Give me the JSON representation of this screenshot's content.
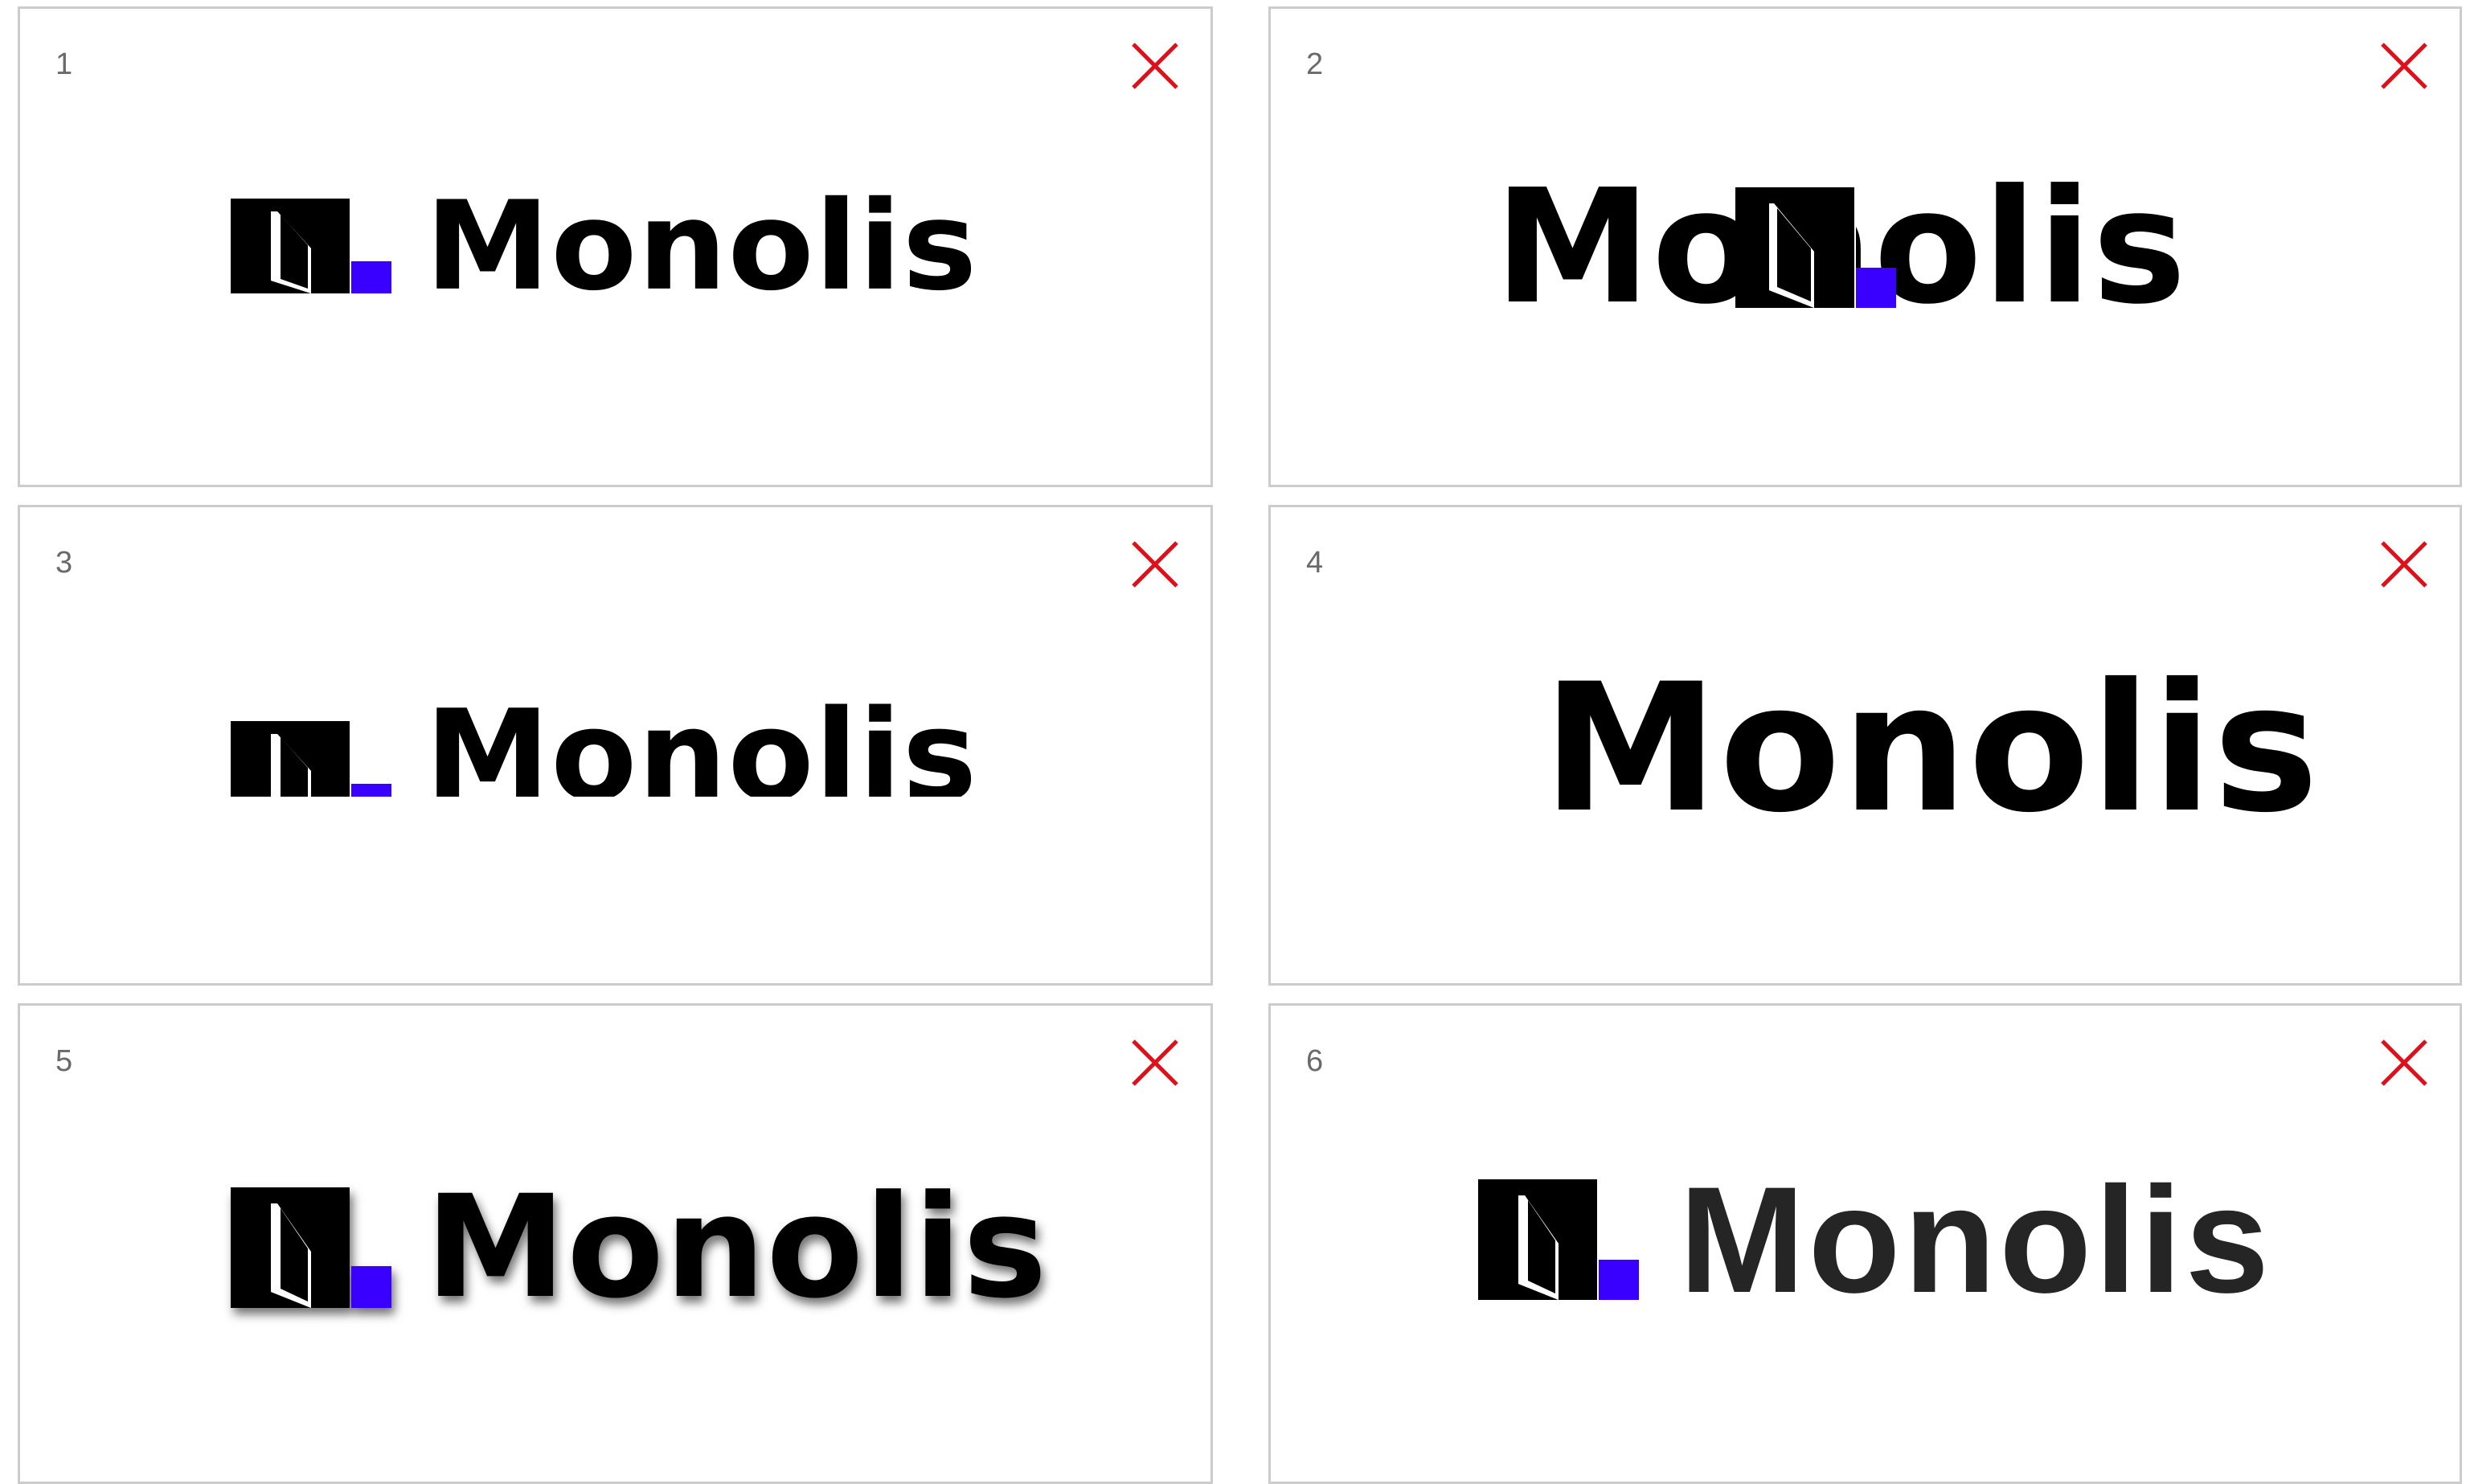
{
  "brand": {
    "wordmark": "Monolis",
    "black": "#000000",
    "accent": "#3a00ff",
    "grey_variant": "#252525"
  },
  "close_icon_color": "#e0101a",
  "cards": [
    {
      "number": "1",
      "description": "correct",
      "close_icon": "x-mark-icon"
    },
    {
      "number": "2",
      "description": "symbol overlapping wordmark",
      "close_icon": "x-mark-icon"
    },
    {
      "number": "3",
      "description": "cropped",
      "close_icon": "x-mark-icon"
    },
    {
      "number": "4",
      "description": "wordmark only",
      "close_icon": "x-mark-icon"
    },
    {
      "number": "5",
      "description": "drop shadow",
      "close_icon": "x-mark-icon"
    },
    {
      "number": "6",
      "description": "different typeface",
      "close_icon": "x-mark-icon"
    }
  ]
}
